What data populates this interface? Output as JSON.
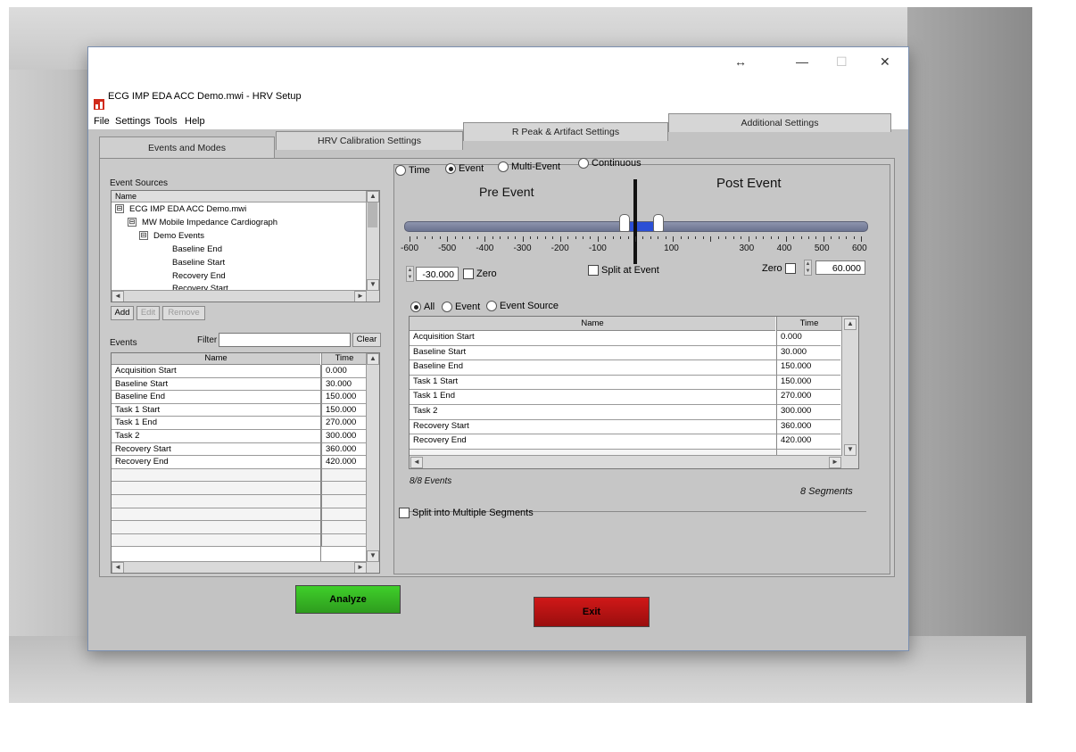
{
  "window": {
    "title": "ECG IMP EDA ACC Demo.mwi - HRV Setup",
    "controls": {
      "resize": "↔",
      "minimize": "—",
      "maximize": "☐",
      "close": "✕"
    }
  },
  "menu": [
    "File",
    "Settings",
    "Tools",
    "Help"
  ],
  "tabs": [
    "Events and Modes",
    "HRV Calibration Settings",
    "R Peak & Artifact Settings",
    "Additional Settings"
  ],
  "event_sources": {
    "label": "Event Sources",
    "header": "Name",
    "tree": [
      {
        "toggle": "⊟",
        "label": "ECG IMP EDA ACC Demo.mwi"
      },
      {
        "toggle": "⊟",
        "label": "MW Mobile Impedance Cardiograph"
      },
      {
        "toggle": "⊟",
        "label": "Demo Events"
      },
      {
        "toggle": "",
        "label": "Baseline End"
      },
      {
        "toggle": "",
        "label": "Baseline Start"
      },
      {
        "toggle": "",
        "label": "Recovery End"
      },
      {
        "toggle": "",
        "label": "Recovery Start"
      }
    ],
    "buttons": {
      "add": "Add",
      "edit": "Edit",
      "remove": "Remove"
    }
  },
  "events_list": {
    "label": "Events",
    "filter_label": "Filter",
    "filter_value": "",
    "clear": "Clear",
    "columns": {
      "name": "Name",
      "time": "Time"
    },
    "rows": [
      {
        "name": "Acquisition Start",
        "time": "0.000"
      },
      {
        "name": "Baseline Start",
        "time": "30.000"
      },
      {
        "name": "Baseline End",
        "time": "150.000"
      },
      {
        "name": "Task 1 Start",
        "time": "150.000"
      },
      {
        "name": "Task 1 End",
        "time": "270.000"
      },
      {
        "name": "Task 2",
        "time": "300.000"
      },
      {
        "name": "Recovery Start",
        "time": "360.000"
      },
      {
        "name": "Recovery End",
        "time": "420.000"
      }
    ]
  },
  "mode": {
    "options": [
      "Time",
      "Event",
      "Multi-Event",
      "Continuous"
    ],
    "selected": "Event"
  },
  "slider": {
    "pre_label": "Pre Event",
    "post_label": "Post Event",
    "ticks": [
      "-600",
      "-500",
      "-400",
      "-300",
      "-200",
      "-100",
      "100",
      "300",
      "400",
      "500",
      "600"
    ],
    "min": -600,
    "max": 600,
    "pre_value": -30,
    "post_value": 60,
    "pre_display": "-30.000",
    "post_display": "60.000",
    "zero_label": "Zero",
    "split_label": "Split at Event",
    "fill_color": "#2b4fd6"
  },
  "filter_options": {
    "options": [
      "All",
      "Event",
      "Event Source"
    ],
    "selected": "All"
  },
  "event_grid": {
    "columns": {
      "name": "Name",
      "time": "Time"
    },
    "rows": [
      {
        "name": "Acquisition Start",
        "time": "0.000"
      },
      {
        "name": "Baseline Start",
        "time": "30.000"
      },
      {
        "name": "Baseline End",
        "time": "150.000"
      },
      {
        "name": "Task 1 Start",
        "time": "150.000"
      },
      {
        "name": "Task 1 End",
        "time": "270.000"
      },
      {
        "name": "Task 2",
        "time": "300.000"
      },
      {
        "name": "Recovery Start",
        "time": "360.000"
      },
      {
        "name": "Recovery End",
        "time": "420.000"
      }
    ],
    "events_count": "8/8 Events",
    "segments_count": "8 Segments"
  },
  "split_segments_label": "Split into Multiple Segments",
  "actions": {
    "analyze": "Analyze",
    "exit": "Exit",
    "analyze_color": "#3fcf2a",
    "exit_color": "#d01818"
  }
}
